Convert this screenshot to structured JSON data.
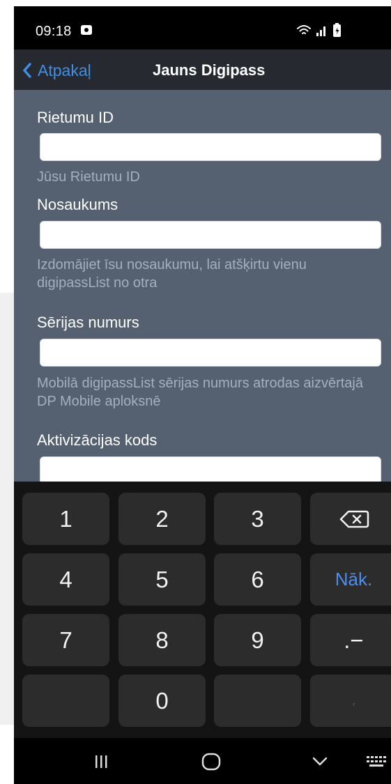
{
  "status_bar": {
    "time": "09:18"
  },
  "nav": {
    "back_label": "Atpakaļ",
    "title": "Jauns Digipass"
  },
  "form": {
    "fields": [
      {
        "label": "Rietumu ID",
        "value": "",
        "hint": "Jūsu Rietumu ID"
      },
      {
        "label": "Nosaukums",
        "value": "",
        "hint": "Izdomājiet īsu nosaukumu, lai atšķirtu vienu digipassList no otra"
      },
      {
        "label": "Sērijas numurs",
        "value": "",
        "hint": "Mobilā digipassList sērijas numurs atrodas aizvērtajā DP Mobile aploksnē"
      },
      {
        "label": "Aktivizācijas kods",
        "value": ""
      }
    ]
  },
  "keyboard": {
    "keys": [
      "1",
      "2",
      "3",
      "4",
      "5",
      "6",
      "7",
      "8",
      "9",
      "0"
    ],
    "next_label": "Nāk.",
    "punct_label": ".−",
    "comma_label": ",",
    "backspace_icon": "backspace-icon"
  },
  "system_nav": {
    "recents_icon": "recents-icon",
    "home_icon": "home-icon",
    "back_icon": "chevron-down-icon",
    "keyboard_icon": "keyboard-icon"
  }
}
